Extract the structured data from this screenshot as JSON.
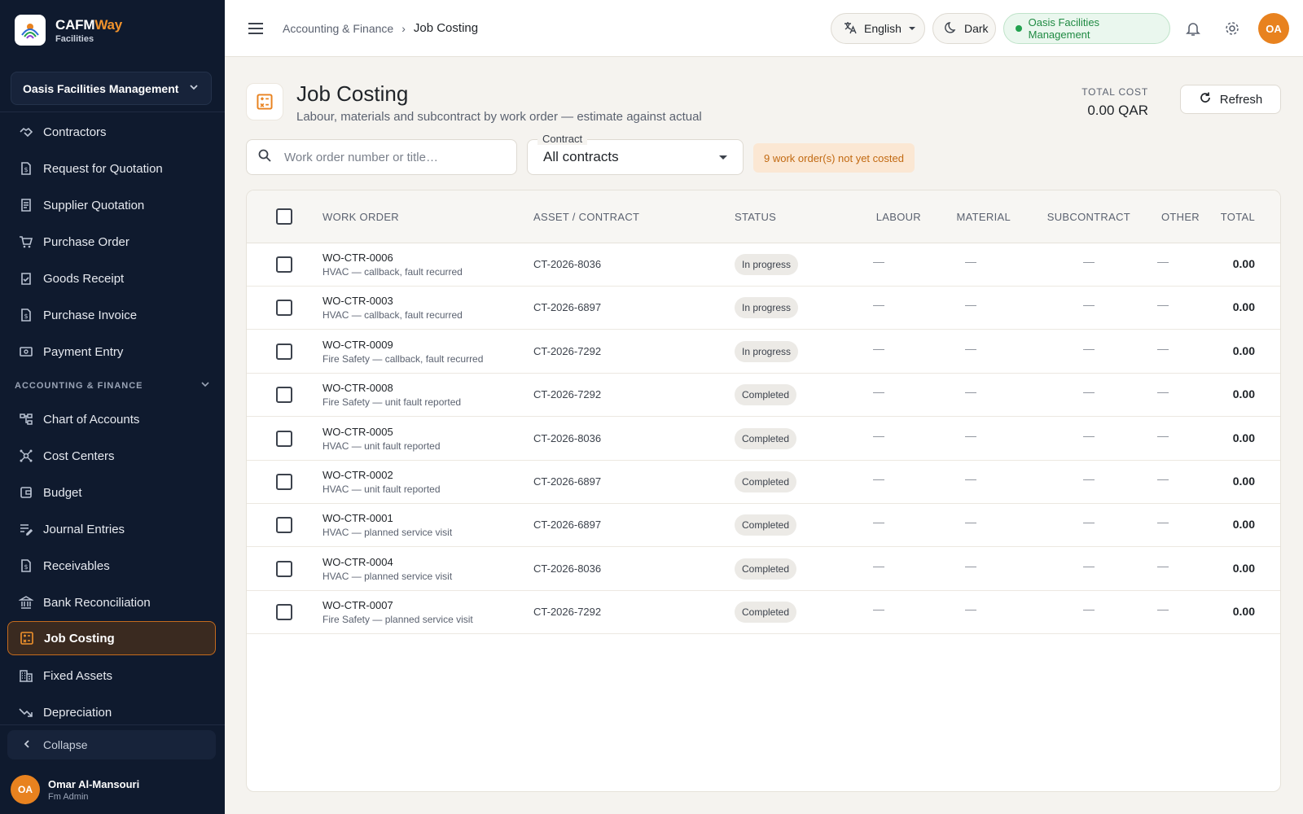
{
  "brand": {
    "name_a": "CAFM",
    "name_b": "Way",
    "sub": "Facilities"
  },
  "sidebar": {
    "org": "Oasis Facilities Management",
    "items": [
      {
        "label": "Contractors",
        "icon": "handshake-icon"
      },
      {
        "label": "Request for Quotation",
        "icon": "document-dollar-icon"
      },
      {
        "label": "Supplier Quotation",
        "icon": "receipt-icon"
      },
      {
        "label": "Purchase Order",
        "icon": "cart-icon"
      },
      {
        "label": "Goods Receipt",
        "icon": "clipboard-check-icon"
      },
      {
        "label": "Purchase Invoice",
        "icon": "invoice-icon"
      },
      {
        "label": "Payment Entry",
        "icon": "payment-icon"
      }
    ],
    "section": "ACCOUNTING & FINANCE",
    "finance_items": [
      {
        "label": "Chart of Accounts",
        "icon": "account-tree-icon"
      },
      {
        "label": "Cost Centers",
        "icon": "hub-icon"
      },
      {
        "label": "Budget",
        "icon": "wallet-icon"
      },
      {
        "label": "Journal Entries",
        "icon": "list-edit-icon"
      },
      {
        "label": "Receivables",
        "icon": "invoice-icon"
      },
      {
        "label": "Bank Reconciliation",
        "icon": "bank-icon"
      },
      {
        "label": "Job Costing",
        "icon": "calculator-icon",
        "active": true
      },
      {
        "label": "Fixed Assets",
        "icon": "building-icon"
      },
      {
        "label": "Depreciation",
        "icon": "trending-down-icon"
      }
    ],
    "collapse": "Collapse",
    "user": {
      "initials": "OA",
      "name": "Omar Al-Mansouri",
      "role": "Fm Admin"
    }
  },
  "topbar": {
    "breadcrumb_parent": "Accounting & Finance",
    "breadcrumb_sep": "›",
    "breadcrumb_current": "Job Costing",
    "language": "English",
    "theme": "Dark",
    "org": "Oasis Facilities Management",
    "avatar": "OA"
  },
  "page": {
    "title": "Job Costing",
    "subtitle": "Labour, materials and subcontract by work order — estimate against actual",
    "total_label": "TOTAL COST",
    "total_value": "0.00 QAR",
    "refresh": "Refresh"
  },
  "filters": {
    "search_placeholder": "Work order number or title…",
    "contract_label": "Contract",
    "contract_value": "All contracts",
    "warning": "9 work order(s) not yet costed"
  },
  "table": {
    "columns": [
      "WORK ORDER",
      "ASSET / CONTRACT",
      "STATUS",
      "LABOUR",
      "MATERIAL",
      "SUBCONTRACT",
      "OTHER",
      "TOTAL"
    ],
    "rows": [
      {
        "wo": "WO-CTR-0006",
        "title": "HVAC — callback, fault recurred",
        "contract": "CT-2026-8036",
        "status": "In progress",
        "labour": "—",
        "material": "—",
        "subcontract": "—",
        "other": "—",
        "total": "0.00"
      },
      {
        "wo": "WO-CTR-0003",
        "title": "HVAC — callback, fault recurred",
        "contract": "CT-2026-6897",
        "status": "In progress",
        "labour": "—",
        "material": "—",
        "subcontract": "—",
        "other": "—",
        "total": "0.00"
      },
      {
        "wo": "WO-CTR-0009",
        "title": "Fire Safety — callback, fault recurred",
        "contract": "CT-2026-7292",
        "status": "In progress",
        "labour": "—",
        "material": "—",
        "subcontract": "—",
        "other": "—",
        "total": "0.00"
      },
      {
        "wo": "WO-CTR-0008",
        "title": "Fire Safety — unit fault reported",
        "contract": "CT-2026-7292",
        "status": "Completed",
        "labour": "—",
        "material": "—",
        "subcontract": "—",
        "other": "—",
        "total": "0.00"
      },
      {
        "wo": "WO-CTR-0005",
        "title": "HVAC — unit fault reported",
        "contract": "CT-2026-8036",
        "status": "Completed",
        "labour": "—",
        "material": "—",
        "subcontract": "—",
        "other": "—",
        "total": "0.00"
      },
      {
        "wo": "WO-CTR-0002",
        "title": "HVAC — unit fault reported",
        "contract": "CT-2026-6897",
        "status": "Completed",
        "labour": "—",
        "material": "—",
        "subcontract": "—",
        "other": "—",
        "total": "0.00"
      },
      {
        "wo": "WO-CTR-0001",
        "title": "HVAC — planned service visit",
        "contract": "CT-2026-6897",
        "status": "Completed",
        "labour": "—",
        "material": "—",
        "subcontract": "—",
        "other": "—",
        "total": "0.00"
      },
      {
        "wo": "WO-CTR-0004",
        "title": "HVAC — planned service visit",
        "contract": "CT-2026-8036",
        "status": "Completed",
        "labour": "—",
        "material": "—",
        "subcontract": "—",
        "other": "—",
        "total": "0.00"
      },
      {
        "wo": "WO-CTR-0007",
        "title": "Fire Safety — planned service visit",
        "contract": "CT-2026-7292",
        "status": "Completed",
        "labour": "—",
        "material": "—",
        "subcontract": "—",
        "other": "—",
        "total": "0.00"
      }
    ]
  },
  "colors": {
    "accent": "#e8821f",
    "sidebar_bg": "#0f1a2e",
    "success": "#22a24f",
    "warning_bg": "#fbe7d3",
    "warning_text": "#c26a12"
  }
}
